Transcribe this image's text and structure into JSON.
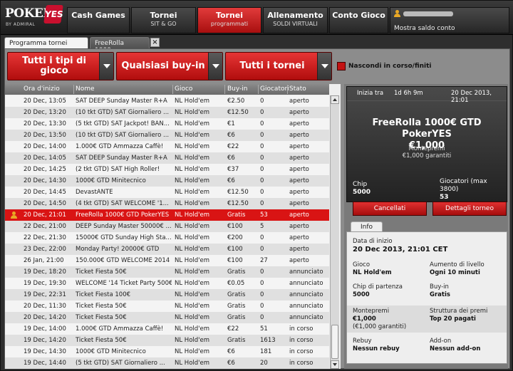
{
  "logo": {
    "brand": "POKER",
    "badge": "YES",
    "sub": "BY ADMIRAL"
  },
  "nav": [
    {
      "label": "Cash Games",
      "sub": ""
    },
    {
      "label": "Tornei",
      "sub": "SIT & GO"
    },
    {
      "label": "Tornei",
      "sub": "programmati"
    },
    {
      "label": "Allenamento",
      "sub": "SOLDI VIRTUALI"
    },
    {
      "label": "Conto Gioco",
      "sub": ""
    }
  ],
  "account": {
    "balance_label": "Mostra saldo conto"
  },
  "tabs": [
    {
      "label": "Programma tornei"
    },
    {
      "label": "FreeRolla 1000..."
    }
  ],
  "filters": {
    "type": "Tutti i tipi di gioco",
    "buyin": "Qualsiasi buy-in",
    "tourn": "Tutti i tornei",
    "hide_label": "Nascondi in corso/finiti"
  },
  "table": {
    "columns": [
      "Ora d'inizio",
      "Nome",
      "Gioco",
      "Buy-in",
      "Giocatori",
      "Stato"
    ],
    "rows": [
      [
        "20 Dec, 13:05",
        "SAT DEEP Sunday Master R+A",
        "NL Hold'em",
        "€2.50",
        "0",
        "aperto"
      ],
      [
        "20 Dec, 13:20",
        "(10 tkt GTD) SAT Giornaliero ...",
        "NL Hold'em",
        "€12.50",
        "0",
        "aperto"
      ],
      [
        "20 Dec, 13:30",
        "(5 tkt GTD) SAT Jackpot! BAN...",
        "NL Hold'em",
        "€1",
        "0",
        "aperto"
      ],
      [
        "20 Dec, 13:50",
        "(10 tkt GTD) SAT Giornaliero ...",
        "NL Hold'em",
        "€6",
        "0",
        "aperto"
      ],
      [
        "20 Dec, 14:00",
        "1.000€ GTD Ammazza Caffè!",
        "NL Hold'em",
        "€22",
        "0",
        "aperto"
      ],
      [
        "20 Dec, 14:05",
        "SAT DEEP Sunday Master R+A",
        "NL Hold'em",
        "€6",
        "0",
        "aperto"
      ],
      [
        "20 Dec, 14:25",
        "(2 tkt GTD) SAT High Roller!",
        "NL Hold'em",
        "€37",
        "0",
        "aperto"
      ],
      [
        "20 Dec, 14:30",
        "1000€ GTD Minitecnico",
        "NL Hold'em",
        "€6",
        "0",
        "aperto"
      ],
      [
        "20 Dec, 14:45",
        "DevastANTE",
        "NL Hold'em",
        "€12.50",
        "0",
        "aperto"
      ],
      [
        "20 Dec, 14:50",
        "(4 tkt GTD) SAT WELCOME '1...",
        "NL Hold'em",
        "€12.50",
        "0",
        "aperto"
      ],
      [
        "20 Dec, 21:01",
        "FreeRolla 1000€ GTD PokerYES",
        "NL Hold'em",
        "Gratis",
        "53",
        "aperto"
      ],
      [
        "22 Dec, 21:00",
        "DEEP Sunday Master 50000€ ...",
        "NL Hold'em",
        "€100",
        "5",
        "aperto"
      ],
      [
        "22 Dec, 21:30",
        "15000€ GTD Sunday High Sta...",
        "NL Hold'em",
        "€200",
        "0",
        "aperto"
      ],
      [
        "23 Dec, 22:00",
        "Monday Party! 20000€ GTD",
        "NL Hold'em",
        "€100",
        "0",
        "aperto"
      ],
      [
        "26 Jan, 21:00",
        "150.000€ GTD WELCOME 2014",
        "NL Hold'em",
        "€100",
        "27",
        "aperto"
      ],
      [
        "19 Dec, 18:20",
        "Ticket Fiesta 50€",
        "NL Hold'em",
        "Gratis",
        "0",
        "annunciato"
      ],
      [
        "19 Dec, 19:30",
        "WELCOME '14 Ticket Party 500€",
        "NL Hold'em",
        "€0.05",
        "0",
        "annunciato"
      ],
      [
        "19 Dec, 22:31",
        "Ticket Fiesta 100€",
        "NL Hold'em",
        "Gratis",
        "0",
        "annunciato"
      ],
      [
        "20 Dec, 11:30",
        "Ticket Fiesta 50€",
        "NL Hold'em",
        "Gratis",
        "0",
        "annunciato"
      ],
      [
        "20 Dec, 14:20",
        "Ticket Fiesta 50€",
        "NL Hold'em",
        "Gratis",
        "0",
        "annunciato"
      ],
      [
        "19 Dec, 14:00",
        "1.000€ GTD Ammazza Caffè!",
        "NL Hold'em",
        "€22",
        "51",
        "in corso"
      ],
      [
        "19 Dec, 14:20",
        "Ticket Fiesta 50€",
        "NL Hold'em",
        "Gratis",
        "1613",
        "in corso"
      ],
      [
        "19 Dec, 14:30",
        "1000€ GTD Minitecnico",
        "NL Hold'em",
        "€6",
        "181",
        "in corso"
      ],
      [
        "19 Dec, 14:40",
        "(5 tkt GTD) SAT Giornaliero ...",
        "NL Hold'em",
        "€6",
        "20",
        "in corso"
      ]
    ]
  },
  "card": {
    "starts_label": "Inizia tra",
    "starts_in": "1d 6h 9m",
    "date": "20 Dec 2013, 21:01",
    "title": "FreeRolla 1000€ GTD PokerYES",
    "prize": "€1,000",
    "prize_label": "Montepremi",
    "prize_sub": "€1,000 garantiti",
    "chip_label": "Chip",
    "chip_value": "5000",
    "players_label": "Giocatori (max 3800)",
    "players_value": "53"
  },
  "buttons": {
    "cancel": "Cancellati",
    "details": "Dettagli torneo"
  },
  "info": {
    "tab": "Info",
    "start_label": "Data di inizio",
    "start_value": "20 Dec 2013, 21:01 CET",
    "game_label": "Gioco",
    "game_value": "NL Hold'em",
    "level_label": "Aumento di livello",
    "level_value": "Ogni 10 minuti",
    "chips_label": "Chip di partenza",
    "chips_value": "5000",
    "buyin_label": "Buy-in",
    "buyin_value": "Gratis",
    "prize_label": "Montepremi",
    "prize_value": "€1,000",
    "prize_sub": "(€1,000 garantiti)",
    "structure_label": "Struttura dei premi",
    "structure_value": "Top 20 pagati",
    "rebuy_label": "Rebuy",
    "rebuy_value": "Nessun rebuy",
    "addon_label": "Add-on",
    "addon_value": "Nessun add-on"
  },
  "colors": {
    "accent": "#d91414",
    "header": "#1c1c1c",
    "panel": "#8c8c8c"
  }
}
